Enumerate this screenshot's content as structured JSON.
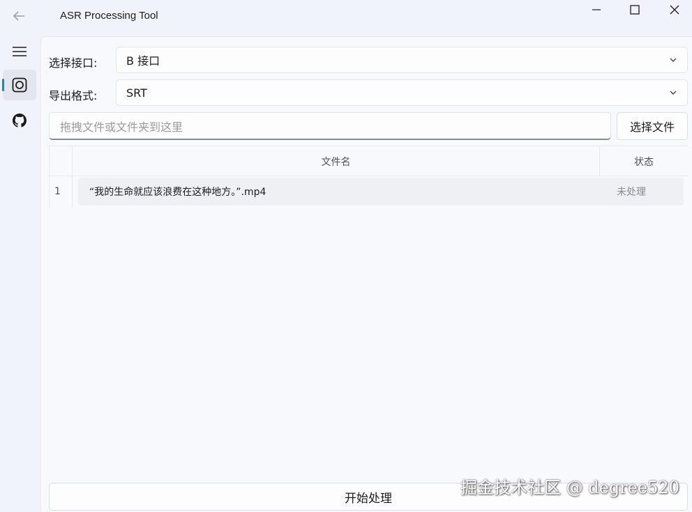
{
  "window": {
    "title": "ASR Processing Tool",
    "controls": [
      "minimize-icon",
      "maximize-icon",
      "close-icon"
    ]
  },
  "sidebar": {
    "items": [
      {
        "icon": "menu-icon"
      },
      {
        "icon": "record-icon",
        "active": true
      },
      {
        "icon": "github-icon"
      }
    ],
    "accent_color": "#0f8fa8"
  },
  "form": {
    "interface_label": "选择接口:",
    "interface_value": "B 接口",
    "format_label": "导出格式:",
    "format_value": "SRT",
    "drop_placeholder": "拖拽文件或文件夹到这里",
    "choose_file_label": "选择文件"
  },
  "table": {
    "columns": [
      "文件名",
      "状态"
    ],
    "rows": [
      {
        "index": "1",
        "filename": "“我的生命就应该浪费在这种地方。”.mp4",
        "status": "未处理"
      }
    ]
  },
  "actions": {
    "start_label": "开始处理"
  },
  "watermark": "掘金技术社区 @ degree520"
}
